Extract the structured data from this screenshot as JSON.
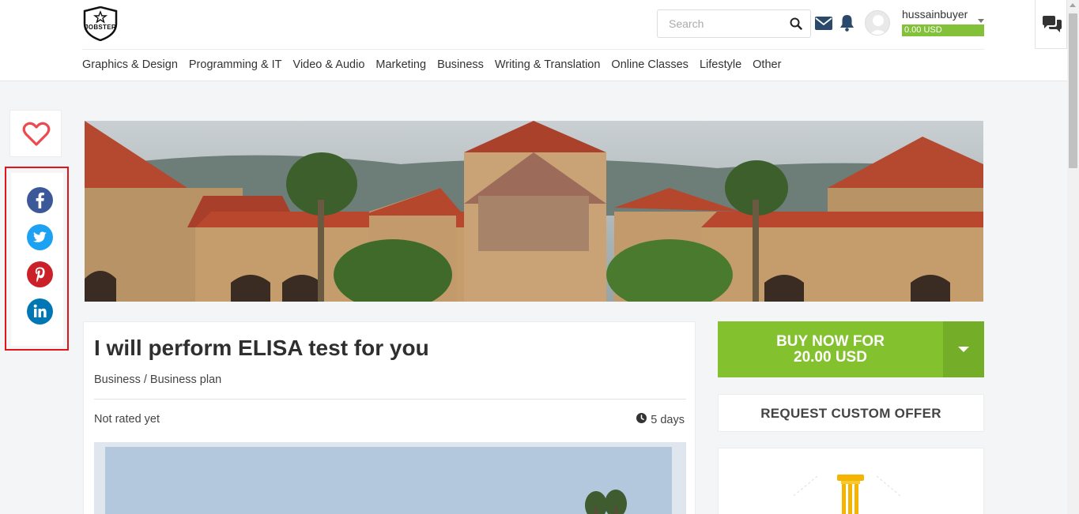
{
  "header": {
    "logo_text": "JOBSTER",
    "search": {
      "placeholder": "Search"
    },
    "user": {
      "name": "hussainbuyer",
      "balance": "0.00 USD"
    }
  },
  "nav": {
    "items": [
      "Graphics & Design",
      "Programming & IT",
      "Video & Audio",
      "Marketing",
      "Business",
      "Writing & Translation",
      "Online Classes",
      "Lifestyle",
      "Other"
    ]
  },
  "gig": {
    "title": "I will perform ELISA test for you",
    "breadcrumb": "Business / Business plan",
    "rating": "Not rated yet",
    "delivery": "5 days"
  },
  "actions": {
    "buy_line1": "BUY NOW FOR",
    "buy_line2": "20.00 USD",
    "custom_offer": "REQUEST CUSTOM OFFER"
  },
  "colors": {
    "accent_green": "#83c12f",
    "highlight_red": "#e4141a",
    "facebook": "#3b5998",
    "twitter": "#1da1f2",
    "pinterest": "#cb2027",
    "linkedin": "#0077b5"
  },
  "icons": [
    "search-icon",
    "envelope-icon",
    "bell-icon",
    "caret-down-icon",
    "chat-icon",
    "heart-icon",
    "facebook-icon",
    "twitter-icon",
    "pinterest-icon",
    "linkedin-icon",
    "clock-icon"
  ]
}
